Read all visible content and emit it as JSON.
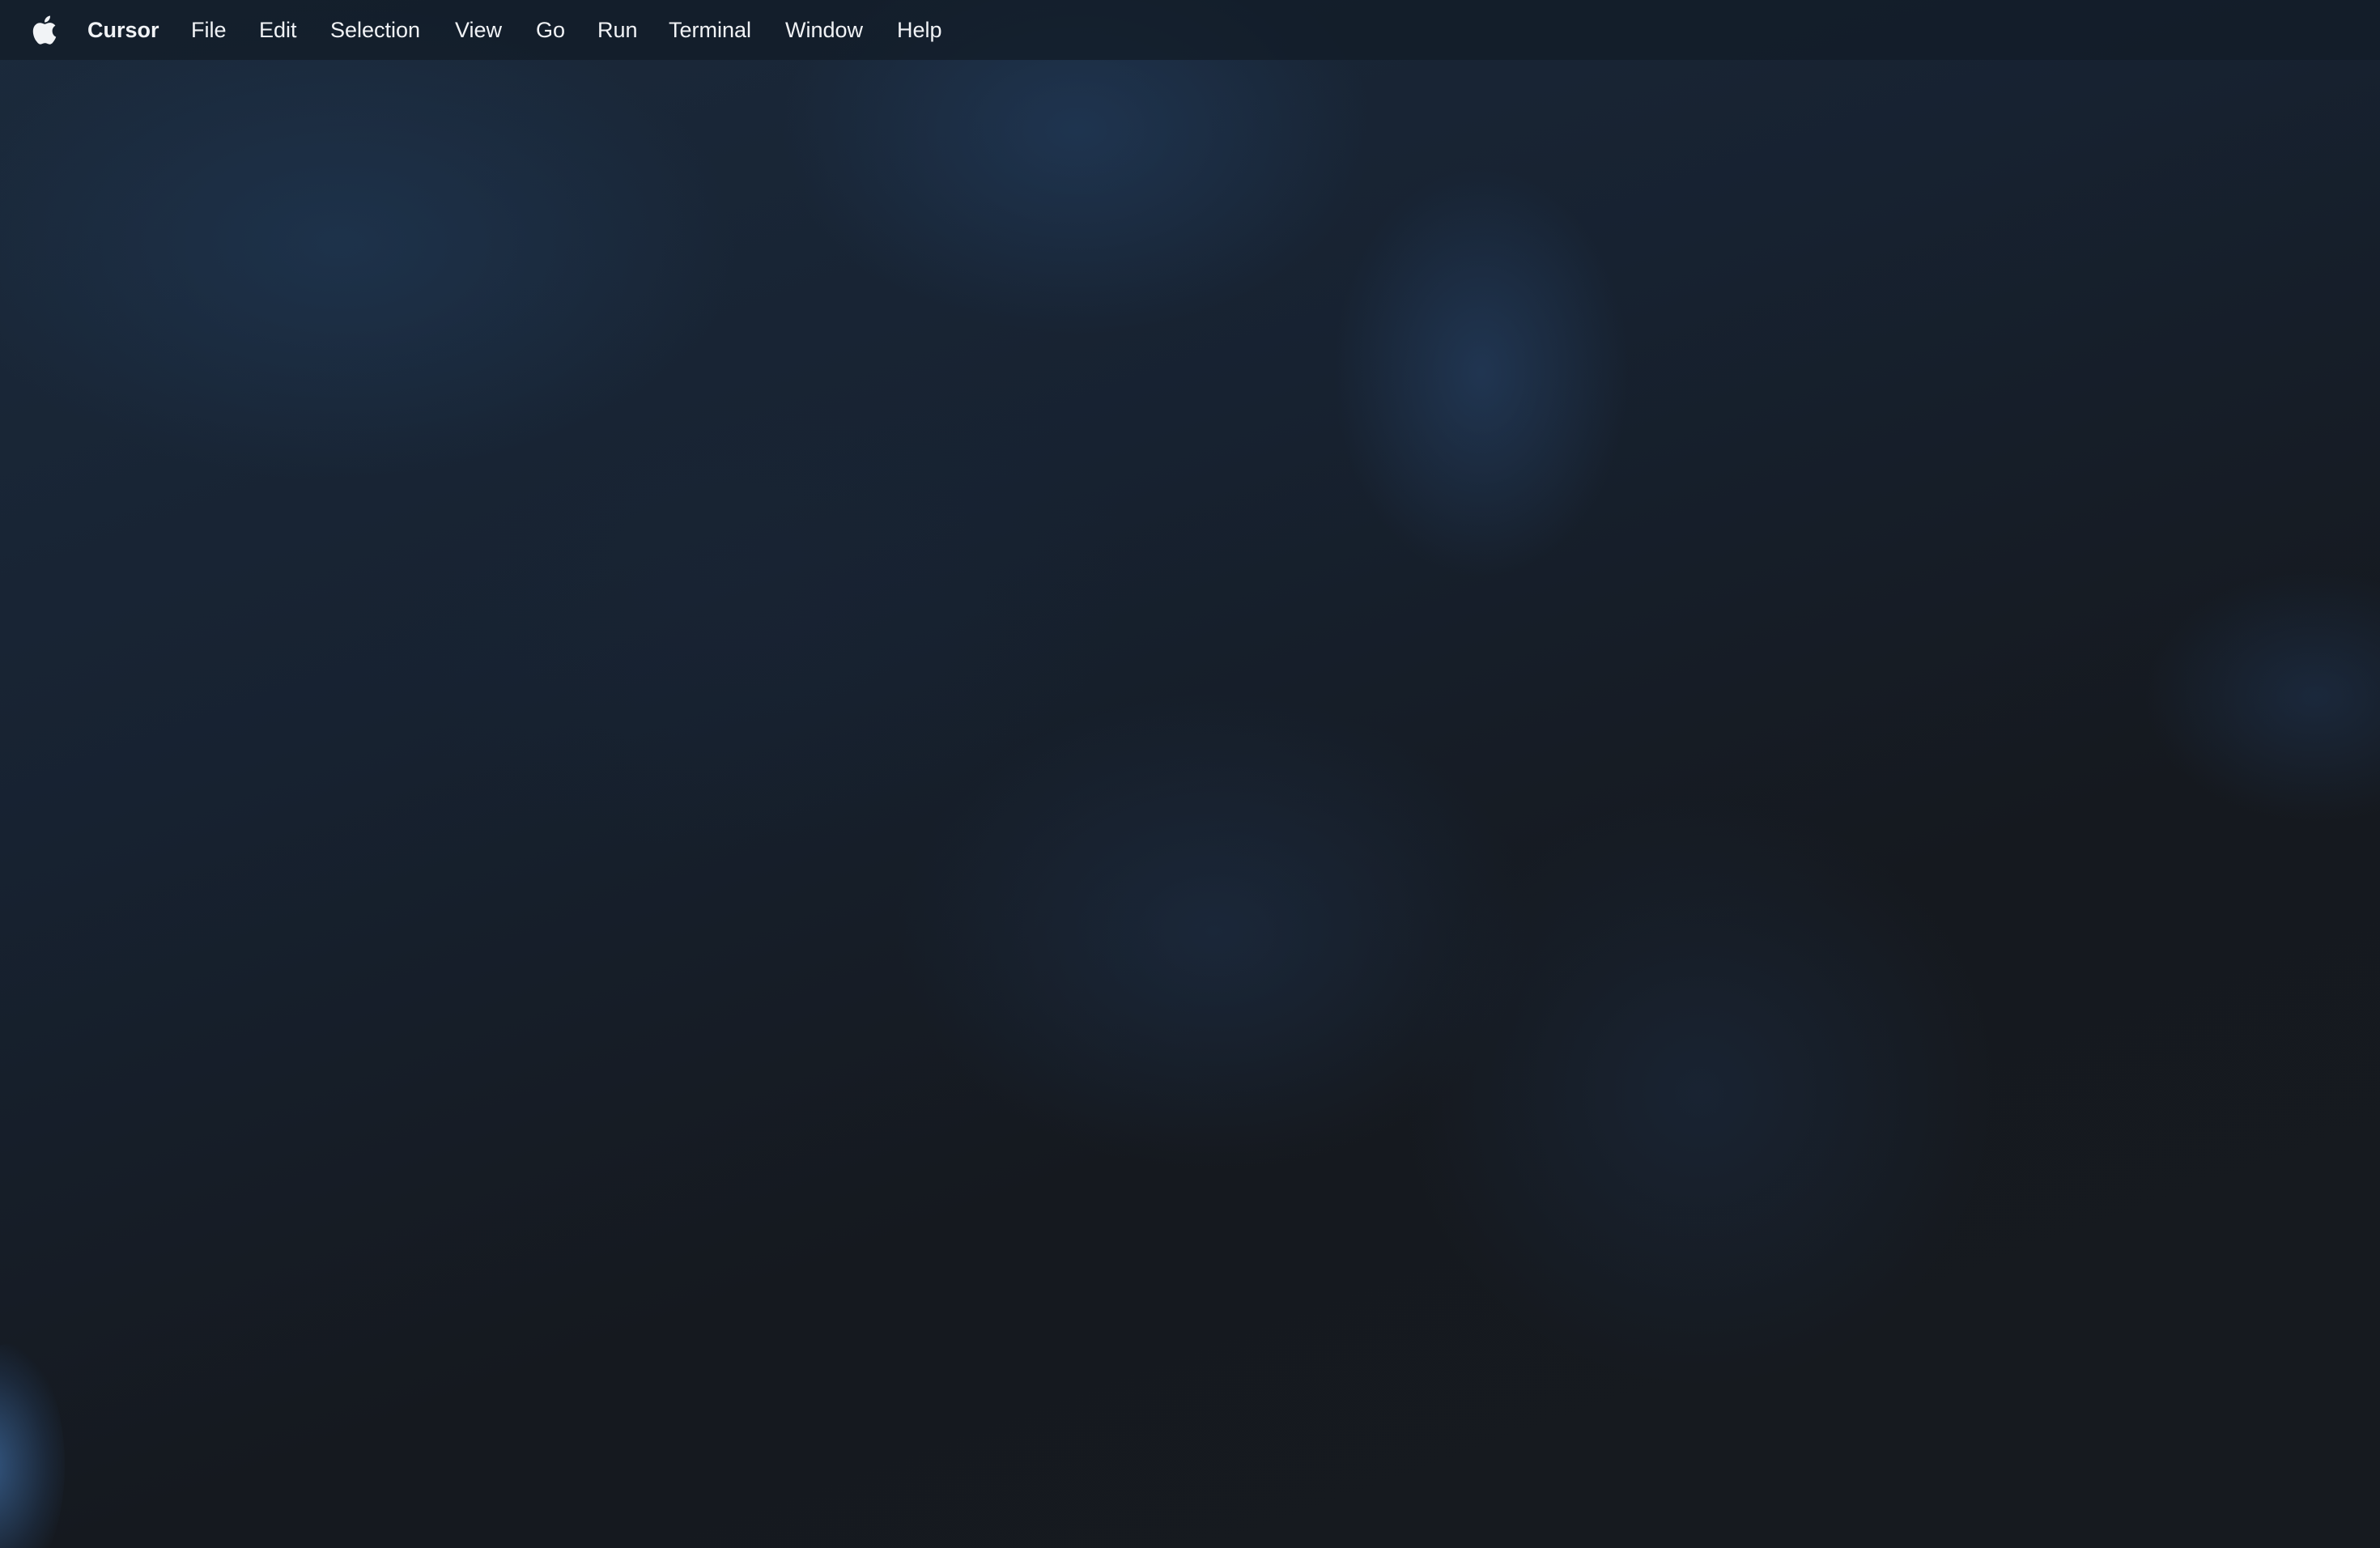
{
  "menubar": {
    "apple_icon": "apple-logo-icon",
    "app_name": "Cursor",
    "items": [
      "File",
      "Edit",
      "Selection",
      "View",
      "Go",
      "Run",
      "Terminal",
      "Window",
      "Help"
    ]
  },
  "colors": {
    "menubar_text": "#f1f3f6",
    "wallpaper_dark": "#16191d",
    "wallpaper_blue": "#1e344e"
  }
}
